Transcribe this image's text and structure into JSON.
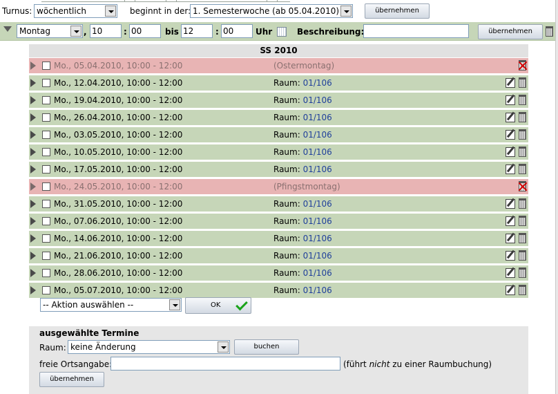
{
  "turnus": {
    "label": "Turnus:",
    "value": "wöchentlich",
    "beginnt_label": "beginnt in der:",
    "beginnt_value": "1. Semesterwoche (ab 05.04.2010)",
    "apply_label": "übernehmen"
  },
  "filter": {
    "weekday": "Montag",
    "sep_comma": ",",
    "start_hour": "10",
    "colon": ":",
    "start_min": "00",
    "bis_label": "bis",
    "end_hour": "12",
    "end_min": "00",
    "uhr_label": "Uhr",
    "beschreibung_label": "Beschreibung:",
    "beschreibung_value": "",
    "apply_label": "übernehmen"
  },
  "semester": {
    "title": "SS 2010"
  },
  "rows": [
    {
      "date": "Mo., 05.04.2010, 10:00 - 12:00",
      "status": "holiday",
      "note": "(Ostermontag)",
      "room_label": "",
      "room": ""
    },
    {
      "date": "Mo., 12.04.2010, 10:00 - 12:00",
      "status": "normal",
      "note": "",
      "room_label": "Raum:",
      "room": "01/106"
    },
    {
      "date": "Mo., 19.04.2010, 10:00 - 12:00",
      "status": "normal",
      "note": "",
      "room_label": "Raum:",
      "room": "01/106"
    },
    {
      "date": "Mo., 26.04.2010, 10:00 - 12:00",
      "status": "normal",
      "note": "",
      "room_label": "Raum:",
      "room": "01/106"
    },
    {
      "date": "Mo., 03.05.2010, 10:00 - 12:00",
      "status": "normal",
      "note": "",
      "room_label": "Raum:",
      "room": "01/106"
    },
    {
      "date": "Mo., 10.05.2010, 10:00 - 12:00",
      "status": "normal",
      "note": "",
      "room_label": "Raum:",
      "room": "01/106"
    },
    {
      "date": "Mo., 17.05.2010, 10:00 - 12:00",
      "status": "normal",
      "note": "",
      "room_label": "Raum:",
      "room": "01/106"
    },
    {
      "date": "Mo., 24.05.2010, 10:00 - 12:00",
      "status": "holiday",
      "note": "(Pfingstmontag)",
      "room_label": "",
      "room": ""
    },
    {
      "date": "Mo., 31.05.2010, 10:00 - 12:00",
      "status": "normal",
      "note": "",
      "room_label": "Raum:",
      "room": "01/106"
    },
    {
      "date": "Mo., 07.06.2010, 10:00 - 12:00",
      "status": "normal",
      "note": "",
      "room_label": "Raum:",
      "room": "01/106"
    },
    {
      "date": "Mo., 14.06.2010, 10:00 - 12:00",
      "status": "normal",
      "note": "",
      "room_label": "Raum:",
      "room": "01/106"
    },
    {
      "date": "Mo., 21.06.2010, 10:00 - 12:00",
      "status": "normal",
      "note": "",
      "room_label": "Raum:",
      "room": "01/106"
    },
    {
      "date": "Mo., 28.06.2010, 10:00 - 12:00",
      "status": "normal",
      "note": "",
      "room_label": "Raum:",
      "room": "01/106"
    },
    {
      "date": "Mo., 05.07.2010, 10:00 - 12:00",
      "status": "normal",
      "note": "",
      "room_label": "Raum:",
      "room": "01/106"
    }
  ],
  "action": {
    "select_value": "-- Aktion auswählen --",
    "ok_label": "OK"
  },
  "selected": {
    "heading": "ausgewählte Termine",
    "raum_label": "Raum:",
    "raum_value": "keine Änderung",
    "buchen_label": "buchen",
    "freie_label": "freie Ortsangabe:",
    "freie_value": "",
    "hint_pre": "(führt ",
    "hint_em": "nicht",
    "hint_post": " zu einer Raumbuchung)",
    "apply_label": "übernehmen"
  },
  "colors": {
    "row_green": "#c6d6b8",
    "row_red": "#e8b4b4",
    "room_link": "#1f3f9a",
    "check_green": "#1aa31a"
  }
}
